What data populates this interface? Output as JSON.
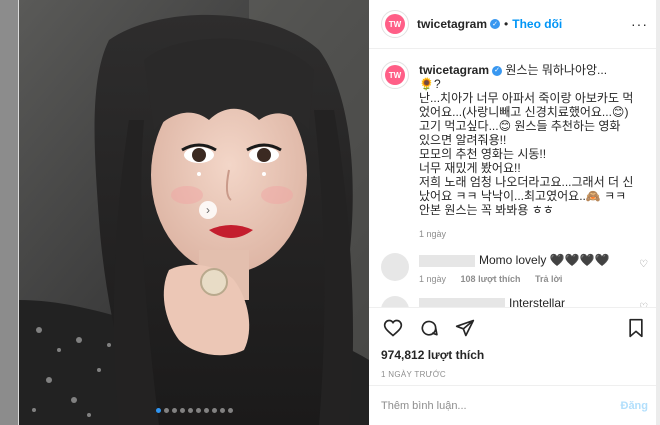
{
  "header": {
    "username": "twicetagram",
    "separator": "•",
    "follow_label": "Theo dõi",
    "more_label": "···",
    "avatar_text": "TW"
  },
  "caption": {
    "username": "twicetagram",
    "lines": [
      "원스는 뭐하나아앙...",
      "🌻?",
      "난...치아가 너무 아파서 죽이랑 아보카도 먹",
      "었어요...(사랑니빼고 신경치료했어요...😊)",
      "고기 먹고싶다...😊 원스들 추천하는 영화",
      "있으면 알려줘용!!",
      "모모의 추천 영화는 시동!!",
      "너무 재밌게 봤어요!!",
      "저희 노래 엄청 나오더라고요...그래서 더 신",
      "났어요 ㅋㅋ 낙낙이...최고였어요..🙈 ㅋㅋ",
      "안본 원스는 꼭 봐봐용 ㅎㅎ"
    ],
    "age": "1 ngày"
  },
  "comments": [
    {
      "text": "Momo lovely 🖤🖤🖤🖤",
      "age": "1 ngày",
      "likes": "108 lượt thích",
      "reply": "Trả lời"
    },
    {
      "text": "Interstellar"
    }
  ],
  "actions": {
    "likes": "974,812 lượt thích",
    "timestamp": "1 NGÀY TRƯỚC"
  },
  "comment_box": {
    "placeholder": "Thêm bình luận...",
    "post_label": "Đăng"
  },
  "colors": {
    "accent": "#0095f6",
    "verified": "#3897f0",
    "brand": "#ff5f87"
  }
}
